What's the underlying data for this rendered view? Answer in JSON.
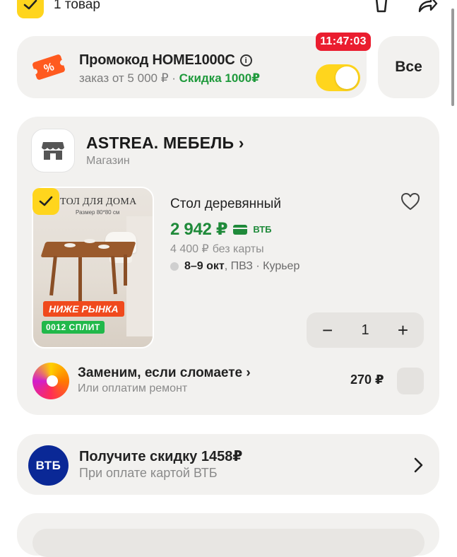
{
  "top": {
    "count_label": "1 товар"
  },
  "promo": {
    "title": "Промокод HOME1000C",
    "condition": "заказ от 5 000 ₽",
    "separator": "·",
    "discount": "Скидка 1000₽",
    "timer": "11:47:03",
    "toggle_on": true
  },
  "all_button": "Все",
  "shop": {
    "name": "ASTREA. МЕБЕЛЬ",
    "chevron": "›",
    "type": "Магазин"
  },
  "product": {
    "image_heading": "ТОЛ ДЛЯ ДОМА",
    "image_size": "Размер 80*80 см",
    "badge_market": "НИЖЕ РЫНКА",
    "badge_split": "0012 СПЛИТ",
    "title": "Стол деревянный",
    "price": "2 942 ₽",
    "price_bank": "ВТБ",
    "old_price": "4 400 ₽",
    "old_price_note": "без карты",
    "delivery_dates": "8–9 окт",
    "delivery_methods": ", ПВЗ · Курьер",
    "quantity": "1",
    "minus": "−",
    "plus": "+"
  },
  "insurance": {
    "title": "Заменим, если сломаете ›",
    "subtitle": "Или оплатим ремонт",
    "price": "270 ₽"
  },
  "vtb": {
    "logo_text": "ВТБ",
    "title": "Получите скидку 1458₽",
    "subtitle": "При оплате картой ВТБ"
  },
  "colors": {
    "accent_yellow": "#ffd51d",
    "green": "#1f8a3a",
    "timer_red": "#ea1d2f",
    "card_bg": "#f2f1ef",
    "vtb_blue": "#0a2896"
  }
}
